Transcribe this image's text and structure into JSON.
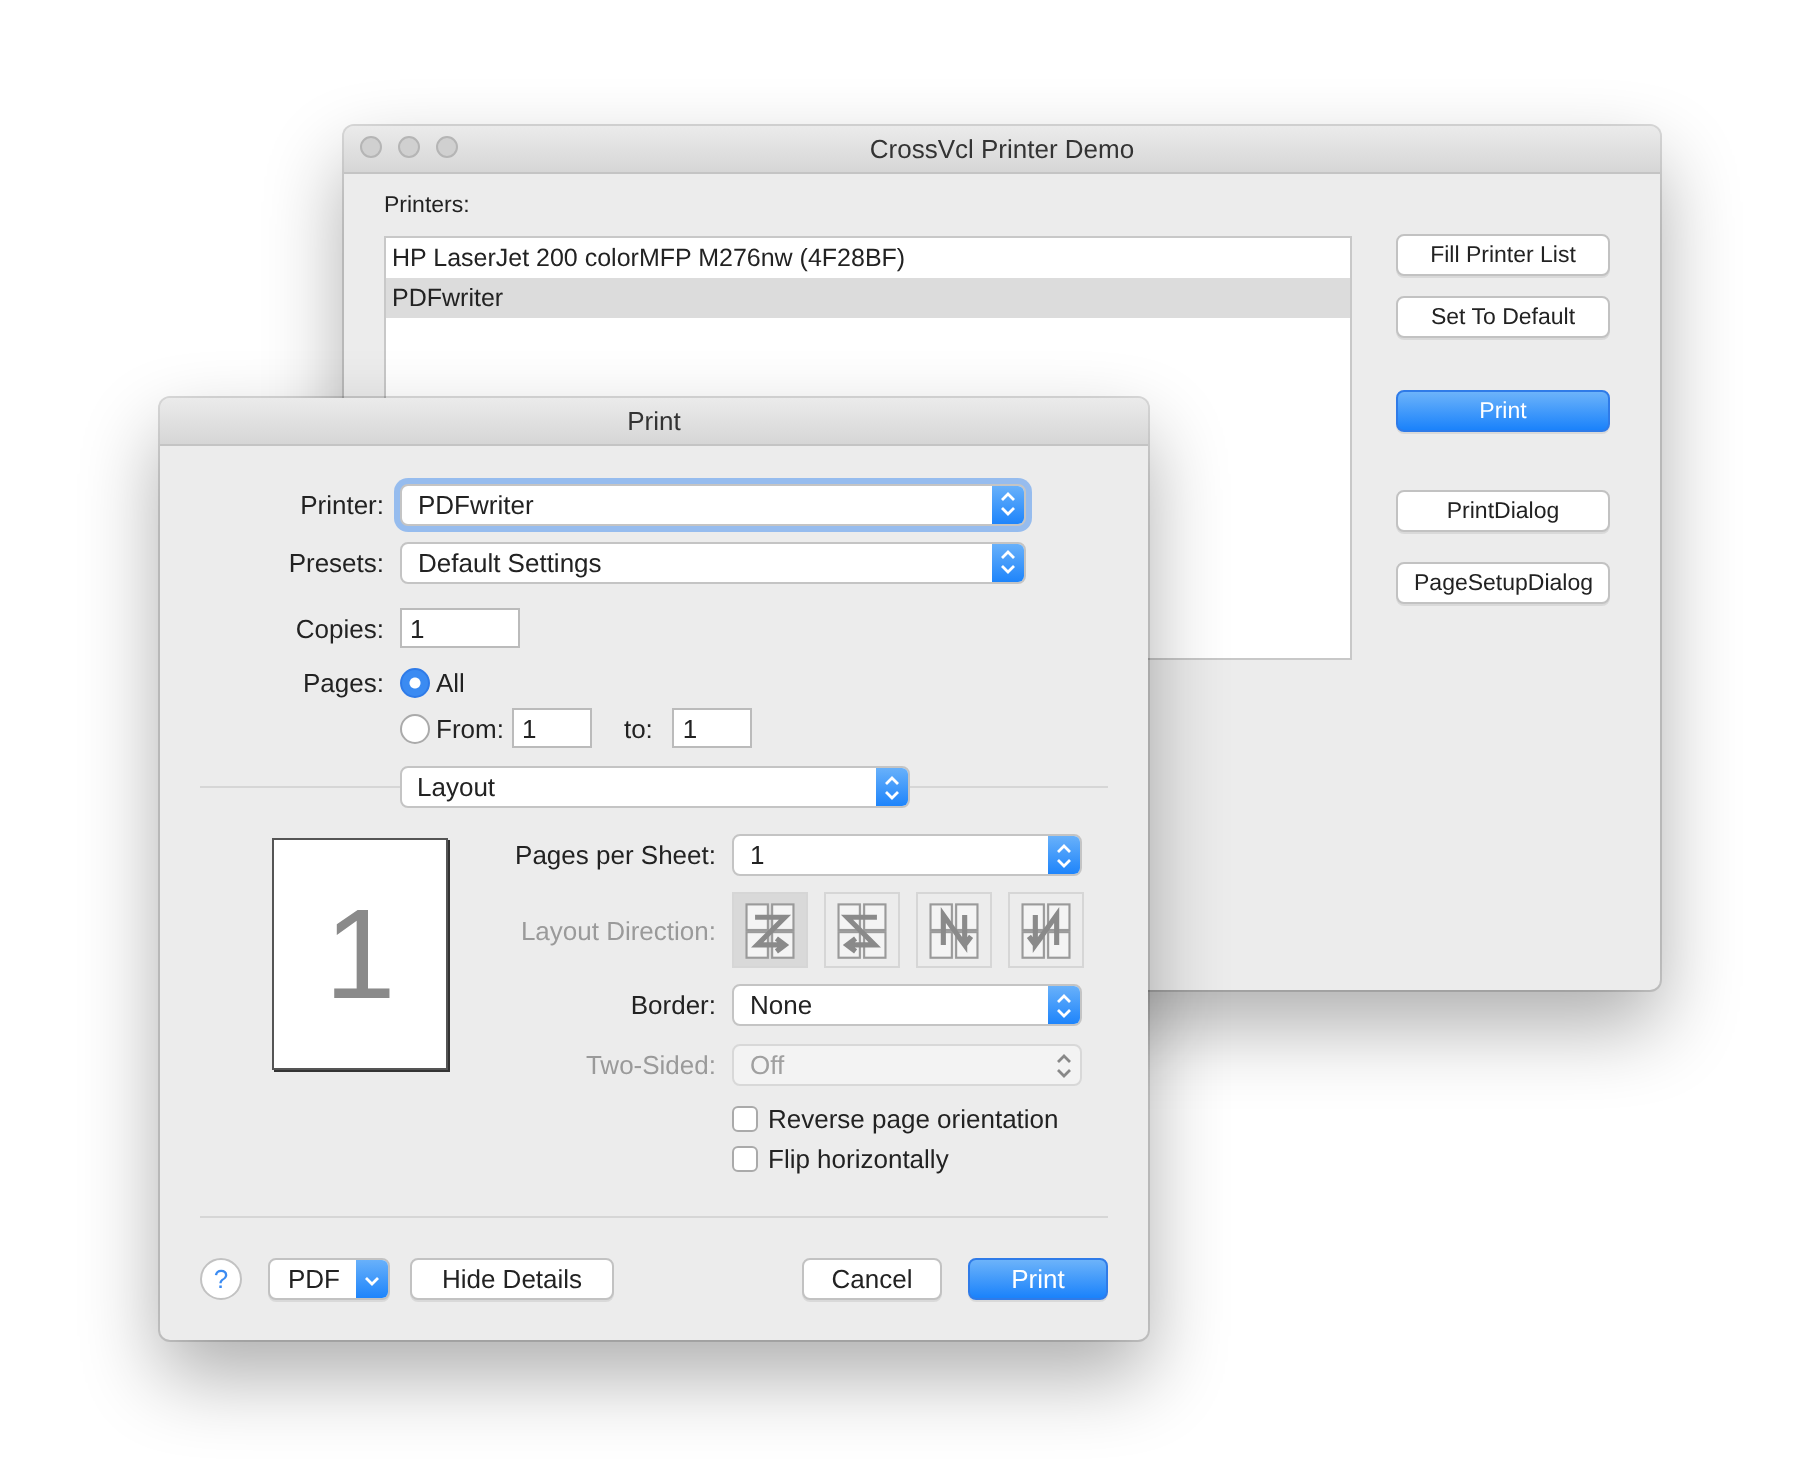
{
  "back_window": {
    "title": "CrossVcl Printer Demo",
    "printers_label": "Printers:",
    "printers": [
      {
        "name": "HP LaserJet 200 colorMFP M276nw (4F28BF)",
        "selected": false
      },
      {
        "name": "PDFwriter",
        "selected": true
      }
    ],
    "buttons": [
      {
        "label": "Fill Printer List",
        "default": false
      },
      {
        "label": "Set To Default",
        "default": false
      },
      {
        "label": "Print",
        "default": true
      },
      {
        "label": "PrintDialog",
        "default": false
      },
      {
        "label": "PageSetupDialog",
        "default": false
      }
    ]
  },
  "print_dialog": {
    "title": "Print",
    "printer": {
      "label": "Printer:",
      "value": "PDFwriter",
      "focused": true
    },
    "presets": {
      "label": "Presets:",
      "value": "Default Settings",
      "focused": false
    },
    "copies": {
      "label": "Copies:",
      "value": "1"
    },
    "pages": {
      "label": "Pages:",
      "options": [
        {
          "label": "All",
          "selected": true
        },
        {
          "label": "From:",
          "selected": false
        }
      ],
      "from": "1",
      "to_label": "to:",
      "to": "1"
    },
    "section": "Layout",
    "preview_page": "1",
    "pages_per_sheet": {
      "label": "Pages per Sheet:",
      "value": "1",
      "disabled": false
    },
    "layout_direction": {
      "label": "Layout Direction:",
      "disabled": true,
      "options": [
        {
          "selected": true
        },
        {
          "selected": false
        },
        {
          "selected": false
        },
        {
          "selected": false
        }
      ]
    },
    "border": {
      "label": "Border:",
      "value": "None",
      "disabled": false
    },
    "two_sided": {
      "label": "Two-Sided:",
      "value": "Off",
      "disabled": true
    },
    "checkboxes": [
      {
        "label": "Reverse page orientation",
        "checked": false
      },
      {
        "label": "Flip horizontally",
        "checked": false
      }
    ],
    "help": "?",
    "pdf": "PDF",
    "buttons": [
      {
        "label": "Hide Details",
        "default": false
      },
      {
        "label": "Cancel",
        "default": false
      },
      {
        "label": "Print",
        "default": true
      }
    ]
  }
}
